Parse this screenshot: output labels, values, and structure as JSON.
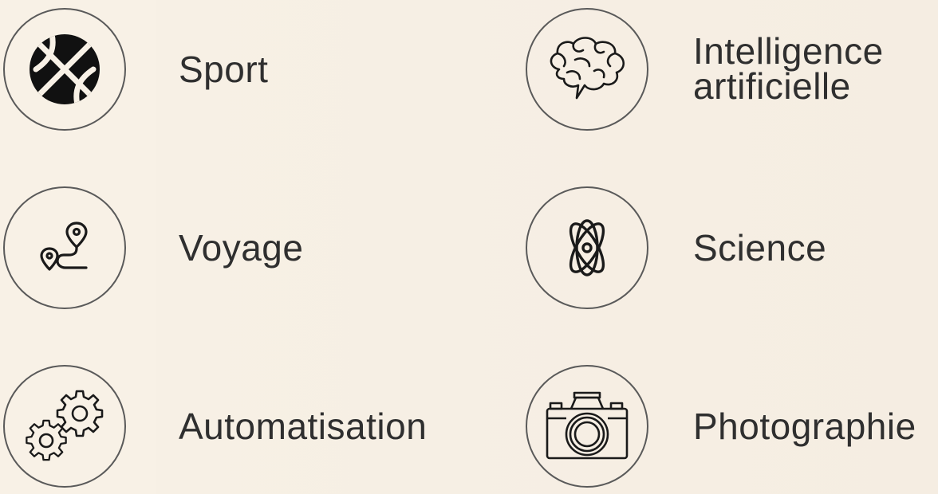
{
  "categories": [
    {
      "label": "Sport",
      "icon": "basketball-icon"
    },
    {
      "label": "Intelligence artificielle",
      "icon": "brain-icon"
    },
    {
      "label": "Voyage",
      "icon": "route-map-pin-icon"
    },
    {
      "label": "Science",
      "icon": "atom-icon"
    },
    {
      "label": "Automatisation",
      "icon": "gears-icon"
    },
    {
      "label": "Photographie",
      "icon": "camera-icon"
    }
  ],
  "colors": {
    "background": "#f8f1e6",
    "stroke": "#1a1a1a",
    "circle_border": "#5a5a5a",
    "text": "#2f2f2f"
  }
}
